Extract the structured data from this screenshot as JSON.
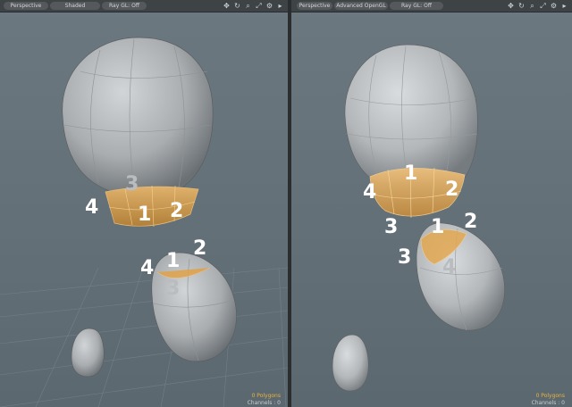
{
  "viewports": [
    {
      "id": "left",
      "toolbar": {
        "view": "Perspective",
        "shading": "Shaded",
        "raygl": "Ray GL: Off"
      },
      "labels": [
        {
          "text": "3",
          "tone": "gray"
        },
        {
          "text": "4",
          "tone": "white"
        },
        {
          "text": "1",
          "tone": "white"
        },
        {
          "text": "2",
          "tone": "white"
        },
        {
          "text": "2",
          "tone": "white"
        },
        {
          "text": "4",
          "tone": "white"
        },
        {
          "text": "1",
          "tone": "white"
        },
        {
          "text": "3",
          "tone": "gray"
        }
      ],
      "status": {
        "polygons": "0 Polygons",
        "channels": "Channels : 0"
      }
    },
    {
      "id": "right",
      "toolbar": {
        "view": "Perspective",
        "shading": "Advanced OpenGL",
        "raygl": "Ray GL: Off"
      },
      "labels": [
        {
          "text": "1",
          "tone": "white"
        },
        {
          "text": "4",
          "tone": "white"
        },
        {
          "text": "2",
          "tone": "white"
        },
        {
          "text": "3",
          "tone": "white"
        },
        {
          "text": "1",
          "tone": "white"
        },
        {
          "text": "2",
          "tone": "white"
        },
        {
          "text": "3",
          "tone": "white"
        },
        {
          "text": "4",
          "tone": "gray"
        }
      ],
      "status": {
        "polygons": "0 Polygons",
        "channels": "Channels : 0"
      }
    }
  ],
  "icons": [
    "move-view-icon",
    "rotate-view-icon",
    "zoom-view-icon",
    "fit-view-icon",
    "settings-gear-icon",
    "menu-arrow-icon"
  ],
  "colors": {
    "selection": "#e0a24a",
    "mesh": "#b8bcbf",
    "background": "#67737b",
    "polygon_status": "#e8b23c"
  }
}
